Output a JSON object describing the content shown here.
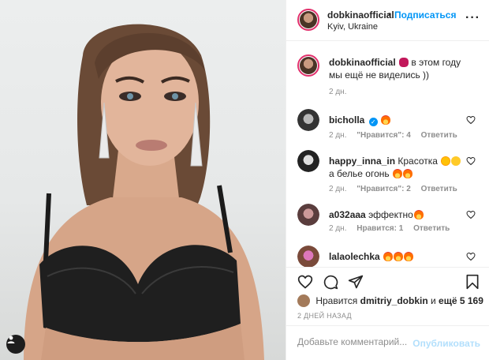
{
  "post": {
    "photo": {
      "tag_icon": "user-tag-icon"
    },
    "header": {
      "username": "dobkinaofficial",
      "separator": "•",
      "follow_label": "Подписаться",
      "location": "Kyiv, Ukraine",
      "more_icon": "more-icon",
      "more_glyph": "···"
    },
    "caption": {
      "username": "dobkinaofficial",
      "text": "в этом году мы ещё не виделись ))",
      "time": "2 дн."
    },
    "comments": [
      {
        "username": "bicholla",
        "verified": true,
        "text": "",
        "time": "2 дн.",
        "likes": "\"Нравится\": 4",
        "reply": "Ответить"
      },
      {
        "username": "happy_inna_in",
        "verified": false,
        "text": "Красотка",
        "text2": "а белье огонь",
        "time": "2 дн.",
        "likes": "\"Нравится\": 2",
        "reply": "Ответить"
      },
      {
        "username": "a032aaa",
        "verified": false,
        "text": "эффектно",
        "time": "2 дн.",
        "likes": "Нравится: 1",
        "reply": "Ответить"
      },
      {
        "username": "lalaolechka",
        "verified": false,
        "text": "",
        "time": "",
        "likes": "",
        "reply": ""
      }
    ],
    "actions": {
      "like_icon": "heart-icon",
      "comment_icon": "comment-icon",
      "share_icon": "share-icon",
      "save_icon": "bookmark-icon"
    },
    "likes": {
      "prefix": "Нравится",
      "user": "dmitriy_dobkin",
      "and": "и",
      "others": "ещё 5 169"
    },
    "date": "2 ДНЕЙ НАЗАД",
    "add_comment": {
      "placeholder": "Добавьте комментарий...",
      "publish_label": "Опубликовать"
    },
    "colors": {
      "link": "#0095f6",
      "muted": "#8e8e8e",
      "ring": "#e1306c",
      "publish_disabled": "#b2dffc"
    }
  }
}
